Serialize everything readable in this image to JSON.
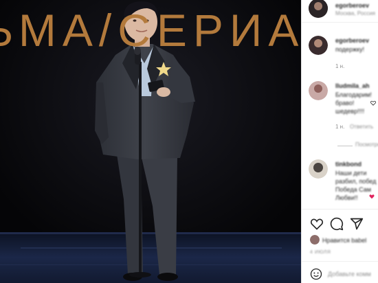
{
  "photo": {
    "backdrop_text": "ЬМА/СЕРИАЛ",
    "colors": {
      "backdrop": "#050507",
      "lettering": "#b37a3c",
      "stage_floor": "#1b2748"
    }
  },
  "post": {
    "author": "egorberoev",
    "caption": "Москва, Россия"
  },
  "comments": [
    {
      "user": "egorberoev",
      "text": "подержку!",
      "time": "1 н.",
      "reply": ""
    },
    {
      "user": "lludmila_ah",
      "text": "Благодарим!",
      "line2": "браво!",
      "line3": "шедевр!!!!",
      "time": "1 н.",
      "reply": "Ответить"
    },
    {
      "user": "",
      "text": "",
      "time": "",
      "reply": "Посмотреть"
    },
    {
      "user": "tinkbond",
      "text": "Наши дети",
      "line2": "разбил, побед",
      "line3": "Победа Сам",
      "line4": "Любви!!",
      "time": "",
      "reply": ""
    }
  ],
  "actions": {
    "like_icon": "heart-icon",
    "comment_icon": "comment-icon",
    "share_icon": "share-icon",
    "likes_text": "Нравится babel",
    "date_text": "4 ИЮЛЯ",
    "add_comment_placeholder": "Добавьте комм",
    "accent": "#e0245e"
  }
}
